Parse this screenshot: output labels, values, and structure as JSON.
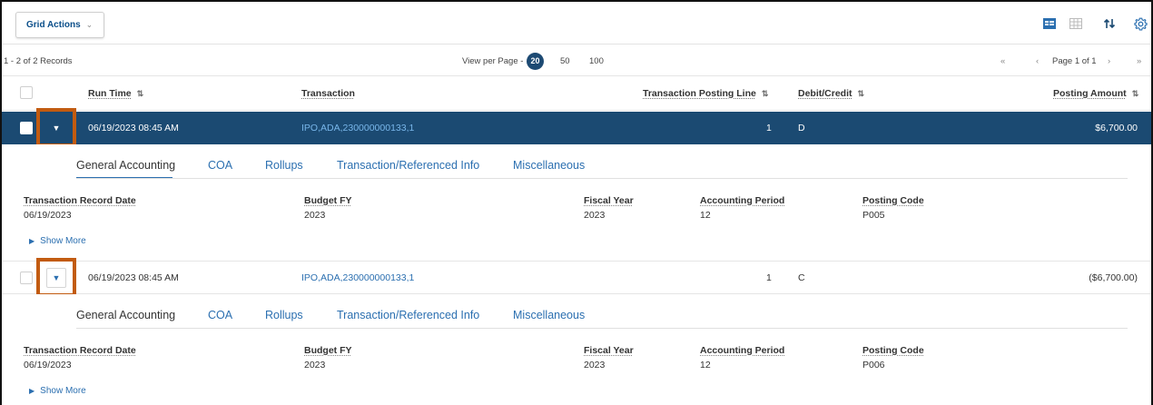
{
  "toolbar": {
    "grid_actions_label": "Grid Actions",
    "icons": [
      "table-view-icon",
      "grid-view-icon",
      "sort-icon",
      "settings-gear-icon"
    ]
  },
  "records": {
    "count_text": "1 - 2 of 2 Records",
    "view_per_page_label": "View per Page -",
    "page_sizes": [
      "20",
      "50",
      "100"
    ],
    "selected_page_size": "20",
    "page_text": "Page 1 of 1"
  },
  "columns": {
    "run_time": "Run Time",
    "transaction": "Transaction",
    "posting_line": "Transaction Posting Line",
    "debit_credit": "Debit/Credit",
    "posting_amount": "Posting Amount"
  },
  "rows": [
    {
      "run_time": "06/19/2023 08:45 AM",
      "transaction": "IPO,ADA,230000000133,1",
      "posting_line": "1",
      "debit_credit": "D",
      "posting_amount": "$6,700.00",
      "detail": {
        "tabs": [
          "General Accounting",
          "COA",
          "Rollups",
          "Transaction/Referenced Info",
          "Miscellaneous"
        ],
        "fields": [
          {
            "label": "Transaction Record Date",
            "value": "06/19/2023"
          },
          {
            "label": "Budget FY",
            "value": "2023"
          },
          {
            "label": "Fiscal Year",
            "value": "2023"
          },
          {
            "label": "Accounting Period",
            "value": "12"
          },
          {
            "label": "Posting Code",
            "value": "P005"
          }
        ],
        "show_more": "Show More"
      }
    },
    {
      "run_time": "06/19/2023 08:45 AM",
      "transaction": "IPO,ADA,230000000133,1",
      "posting_line": "1",
      "debit_credit": "C",
      "posting_amount": "($6,700.00)",
      "detail": {
        "tabs": [
          "General Accounting",
          "COA",
          "Rollups",
          "Transaction/Referenced Info",
          "Miscellaneous"
        ],
        "fields": [
          {
            "label": "Transaction Record Date",
            "value": "06/19/2023"
          },
          {
            "label": "Budget FY",
            "value": "2023"
          },
          {
            "label": "Fiscal Year",
            "value": "2023"
          },
          {
            "label": "Accounting Period",
            "value": "12"
          },
          {
            "label": "Posting Code",
            "value": "P006"
          }
        ],
        "show_more": "Show More"
      }
    }
  ],
  "colors": {
    "selected_row": "#1b4a72",
    "highlight_box": "#c25b10",
    "link": "#2b6fb0"
  }
}
